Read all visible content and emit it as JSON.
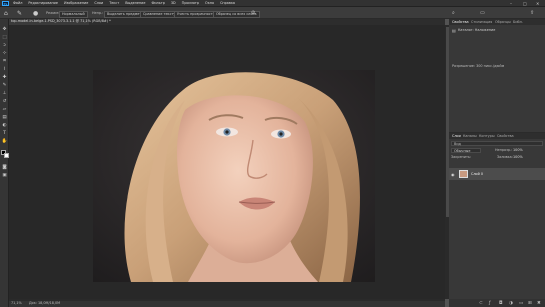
{
  "menubar": {
    "logo": "Ps",
    "items": [
      "Файл",
      "Редактирование",
      "Изображение",
      "Слои",
      "Текст",
      "Выделение",
      "Фильтр",
      "3D",
      "Просмотр",
      "Окно",
      "Справка"
    ],
    "window_controls": [
      "–",
      "□",
      "✕"
    ]
  },
  "options": {
    "mode_label": "Режим:",
    "mode_value": "Нормальный",
    "opacity_label": "Непр.:",
    "select_subject": "Выделить предмет",
    "add_texture": "Сравнение текстуры",
    "content_aware": "Учесть прозрачность",
    "sample_all": "Образец со всех слоев"
  },
  "document": {
    "tab_title": "top-model-in-beige-1.PSD_3073.3.1.1 @ 71,1% (RGB/8#) *",
    "status_zoom": "71,1%",
    "status_doc": "Док: 18,0M/18,0M"
  },
  "history": {
    "tabs": [
      "Свойства",
      "Стилизация",
      "Образцы",
      "Библ."
    ],
    "items": [
      "Каталог: Наложение",
      "Разрешение: 300 пикс./дюйм"
    ]
  },
  "layers": {
    "tabs": [
      "Слои",
      "Каналы",
      "Контуры",
      "Свойства"
    ],
    "search_placeholder": "Вид",
    "blend_mode": "Обычные",
    "opacity_label": "Непрозр.:",
    "opacity_value": "100%",
    "lock_label": "Закрепить:",
    "fill_label": "Заливка:",
    "fill_value": "100%",
    "layer_name": "Слой 0"
  },
  "colors": {
    "accent": "#31a8ff",
    "panel": "#383838",
    "canvas": "#282828"
  }
}
